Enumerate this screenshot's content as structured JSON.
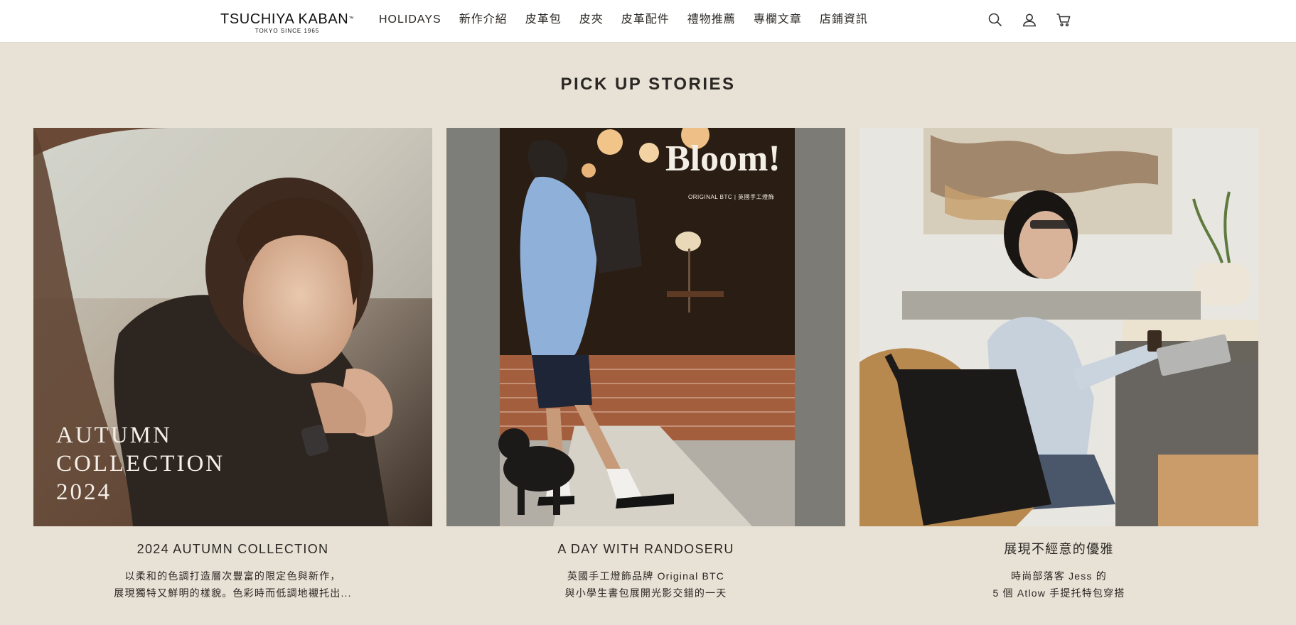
{
  "brand": {
    "name": "TSUCHIYA KABAN",
    "trademark": "™",
    "tagline": "TOKYO SINCE 1965"
  },
  "nav": {
    "items": [
      {
        "label": "HOLIDAYS"
      },
      {
        "label": "新作介紹"
      },
      {
        "label": "皮革包"
      },
      {
        "label": "皮夾"
      },
      {
        "label": "皮革配件"
      },
      {
        "label": "禮物推薦"
      },
      {
        "label": "專欄文章"
      },
      {
        "label": "店鋪資訊"
      }
    ]
  },
  "header_icons": [
    "search-icon",
    "account-icon",
    "cart-icon"
  ],
  "section": {
    "title": "PICK UP STORIES"
  },
  "stories": [
    {
      "image_overlay": [
        "AUTUMN",
        "COLLECTION",
        "2024"
      ],
      "title": "2024 AUTUMN COLLECTION",
      "desc_line1": "以柔和的色調打造層次豐富的限定色與新作，",
      "desc_line2": "展現獨特又鮮明的樣貌。色彩時而低調地襯托出..."
    },
    {
      "image_sign": "Bloom!",
      "image_sign_sub": "ORIGINAL BTC | 英國手工燈飾",
      "title": "A DAY WITH RANDOSERU",
      "desc_line1": "英國手工燈飾品牌 Original BTC",
      "desc_line2": "與小學生書包展開光影交錯的一天"
    },
    {
      "title": "展現不經意的優雅",
      "desc_line1": "時尚部落客 Jess 的",
      "desc_line2": "5 個 Atlow 手提托特包穿搭"
    }
  ],
  "colors": {
    "page_bg": "#e8e1d5",
    "header_bg": "#ffffff",
    "text": "#2a2724"
  }
}
